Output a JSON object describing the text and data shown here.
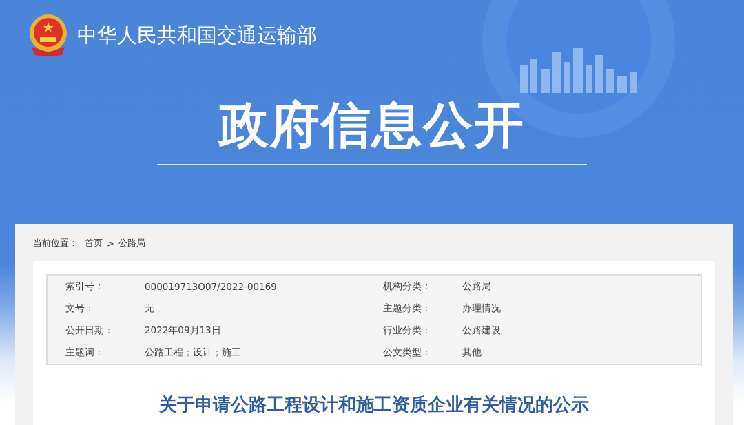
{
  "header": {
    "site_title": "中华人民共和国交通运输部"
  },
  "banner": {
    "title": "政府信息公开"
  },
  "breadcrumb": {
    "label": "当前位置：",
    "items": [
      {
        "text": "首页"
      },
      {
        "text": "公路局"
      }
    ],
    "separator": ">"
  },
  "metadata": [
    {
      "label": "索引号：",
      "value": "000019713O07/2022-00169"
    },
    {
      "label": "机构分类：",
      "value": "公路局"
    },
    {
      "label": "文号：",
      "value": "无"
    },
    {
      "label": "主题分类：",
      "value": "办理情况"
    },
    {
      "label": "公开日期：",
      "value": "2022年09月13日"
    },
    {
      "label": "行业分类：",
      "value": "公路建设"
    },
    {
      "label": "主题词：",
      "value": "公路工程；设计；施工"
    },
    {
      "label": "公文类型：",
      "value": "其他"
    }
  ],
  "article": {
    "title": "关于申请公路工程设计和施工资质企业有关情况的公示"
  }
}
